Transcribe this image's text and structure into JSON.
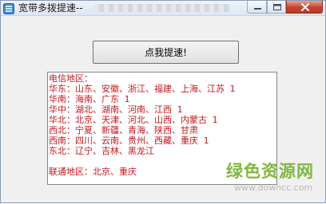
{
  "window": {
    "title": "宽带多拨提速--"
  },
  "main": {
    "speed_button_label": "点我提速!",
    "output_lines": [
      "电信地区：",
      "华东：山东、安徽、浙江、福建、上海、江苏 1",
      "华南：海南、广东 1",
      "华中：湖北、湖南、河南、江西 1",
      "华北：北京、天津、河北、山西、内蒙古 1",
      "西北：宁夏、新疆、青海、陕西、甘肃",
      "西南：四川、云南、贵州、西藏、重庆 1",
      "东北：辽宁、吉林、黑龙江",
      "",
      "联通地区：北京、重庆"
    ]
  },
  "watermark": {
    "logo_text": "绿色资源网",
    "url": "www.downcc.com"
  },
  "colors": {
    "output_text": "#c4161c",
    "watermark_green": "#7fb83d"
  },
  "icons": {
    "app": "app-icon",
    "minimize": "minimize-icon",
    "maximize": "maximize-icon",
    "close": "close-icon"
  }
}
